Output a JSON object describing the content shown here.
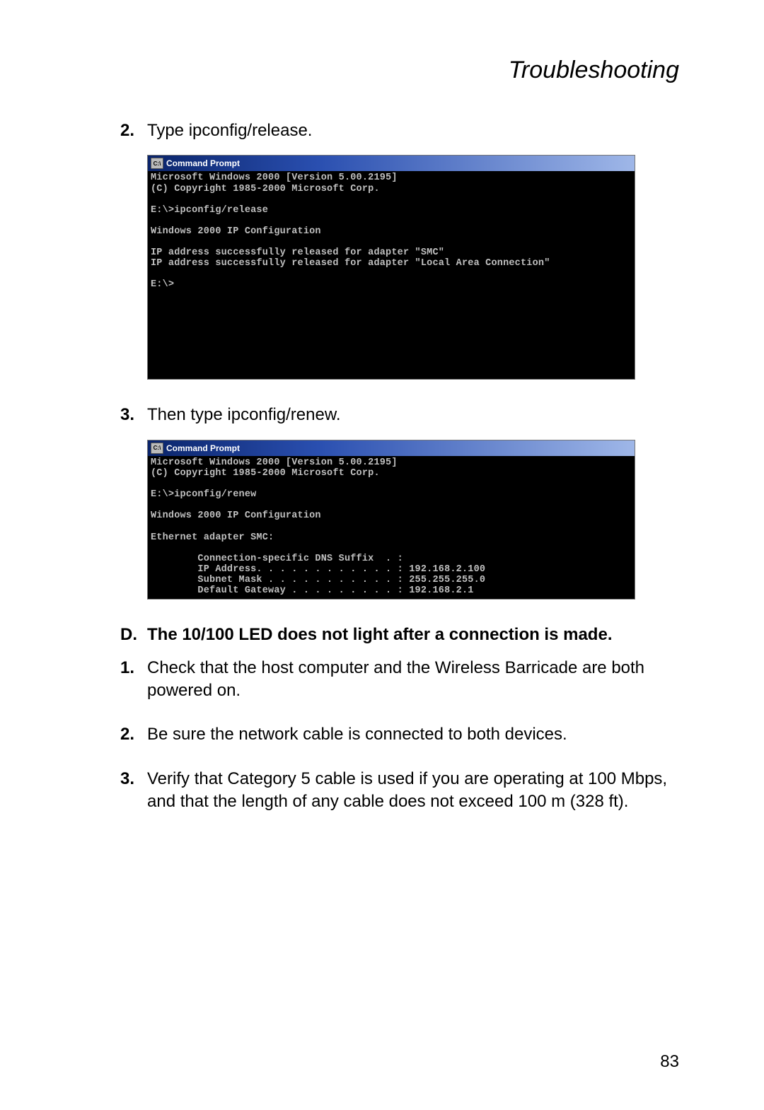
{
  "header": {
    "title": "Troubleshooting"
  },
  "steps_top": {
    "s2": {
      "num": "2.",
      "text": "Type ipconfig/release."
    },
    "s3": {
      "num": "3.",
      "text": "Then type ipconfig/renew."
    }
  },
  "cmd1": {
    "title": "Command Prompt",
    "icon_text": "C:\\",
    "body": "Microsoft Windows 2000 [Version 5.00.2195]\n(C) Copyright 1985-2000 Microsoft Corp.\n\nE:\\>ipconfig/release\n\nWindows 2000 IP Configuration\n\nIP address successfully released for adapter \"SMC\"\nIP address successfully released for adapter \"Local Area Connection\"\n\nE:\\>"
  },
  "cmd2": {
    "title": "Command Prompt",
    "icon_text": "C:\\",
    "body": "Microsoft Windows 2000 [Version 5.00.2195]\n(C) Copyright 1985-2000 Microsoft Corp.\n\nE:\\>ipconfig/renew\n\nWindows 2000 IP Configuration\n\nEthernet adapter SMC:\n\n        Connection-specific DNS Suffix  . :\n        IP Address. . . . . . . . . . . . : 192.168.2.100\n        Subnet Mask . . . . . . . . . . . : 255.255.255.0\n        Default Gateway . . . . . . . . . : 192.168.2.1"
  },
  "sectionD": {
    "num": "D.",
    "title": "The 10/100 LED does not light after a connection is made.",
    "items": {
      "i1": {
        "num": "1.",
        "text": "Check that the host computer and the Wireless Barricade are both powered on."
      },
      "i2": {
        "num": "2.",
        "text": "Be sure the network cable is connected to both devices."
      },
      "i3": {
        "num": "3.",
        "text": "Verify that Category 5 cable is used if you are operating at 100 Mbps, and that the length of any cable does not exceed 100 m (328 ft)."
      }
    }
  },
  "page_number": "83"
}
